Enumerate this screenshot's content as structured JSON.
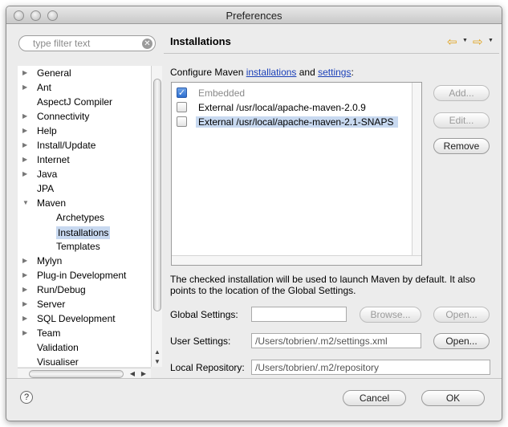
{
  "window": {
    "title": "Preferences"
  },
  "filter": {
    "placeholder": "type filter text"
  },
  "tree": {
    "items": [
      {
        "label": "General",
        "expandable": true
      },
      {
        "label": "Ant",
        "expandable": true
      },
      {
        "label": "AspectJ Compiler",
        "expandable": false
      },
      {
        "label": "Connectivity",
        "expandable": true
      },
      {
        "label": "Help",
        "expandable": true
      },
      {
        "label": "Install/Update",
        "expandable": true
      },
      {
        "label": "Internet",
        "expandable": true
      },
      {
        "label": "Java",
        "expandable": true
      },
      {
        "label": "JPA",
        "expandable": false
      },
      {
        "label": "Maven",
        "expandable": true,
        "expanded": true
      },
      {
        "label": "Archetypes",
        "child": true
      },
      {
        "label": "Installations",
        "child": true,
        "selected": true
      },
      {
        "label": "Templates",
        "child": true
      },
      {
        "label": "Mylyn",
        "expandable": true
      },
      {
        "label": "Plug-in Development",
        "expandable": true
      },
      {
        "label": "Run/Debug",
        "expandable": true
      },
      {
        "label": "Server",
        "expandable": true
      },
      {
        "label": "SQL Development",
        "expandable": true
      },
      {
        "label": "Team",
        "expandable": true
      },
      {
        "label": "Validation",
        "expandable": false
      },
      {
        "label": "Visualiser",
        "expandable": false
      }
    ]
  },
  "page": {
    "title": "Installations",
    "intro_prefix": "Configure Maven ",
    "intro_link1": "installations",
    "intro_and": " and ",
    "intro_link2": "settings",
    "intro_suffix": ":"
  },
  "installations": [
    {
      "label": "Embedded",
      "checked": true,
      "disabled": true
    },
    {
      "label": "External /usr/local/apache-maven-2.0.9",
      "checked": false
    },
    {
      "label": "External /usr/local/apache-maven-2.1-SNAPS",
      "checked": false,
      "selected": true
    }
  ],
  "buttons": {
    "add": "Add...",
    "edit": "Edit...",
    "remove": "Remove",
    "browse": "Browse...",
    "open_global": "Open...",
    "open_user": "Open...",
    "cancel": "Cancel",
    "ok": "OK"
  },
  "note": "The checked installation will be used to launch Maven by default. It also points to the location of the Global Settings.",
  "fields": {
    "global_label": "Global Settings:",
    "global_value": "",
    "user_label": "User Settings:",
    "user_value": "/Users/tobrien/.m2/settings.xml",
    "repo_label": "Local Repository:",
    "repo_value": "/Users/tobrien/.m2/repository"
  },
  "help": {
    "glyph": "?"
  },
  "colors": {
    "selection": "#c8d9f0",
    "link": "#1a3fb8",
    "nav_arrow": "#e0a21c"
  }
}
